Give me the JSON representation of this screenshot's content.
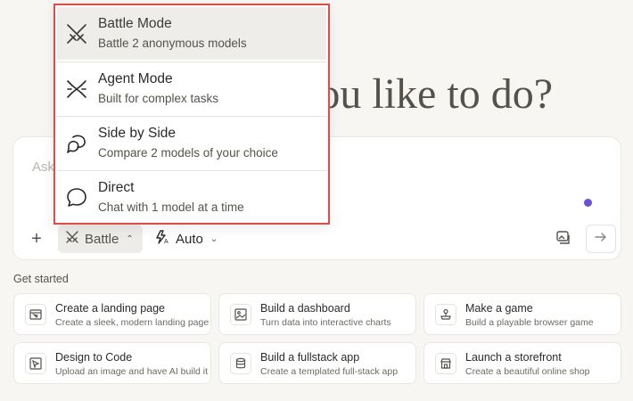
{
  "headline": "ou like to do?",
  "composer": {
    "placeholder": "Ask",
    "mode_label": "Battle",
    "model_label": "Auto"
  },
  "dropdown": {
    "options": [
      {
        "label": "Battle Mode",
        "desc": "Battle 2 anonymous models",
        "icon": "crossed-swords-icon",
        "selected": true
      },
      {
        "label": "Agent Mode",
        "desc": "Built for complex tasks",
        "icon": "agent-icon",
        "selected": false
      },
      {
        "label": "Side by Side",
        "desc": "Compare 2 models of your choice",
        "icon": "chat-bubbles-icon",
        "selected": false
      },
      {
        "label": "Direct",
        "desc": "Chat with 1 model at a time",
        "icon": "chat-bubble-icon",
        "selected": false
      }
    ]
  },
  "get_started": {
    "title": "Get started",
    "cards": [
      {
        "title": "Create a landing page",
        "subtitle": "Create a sleek, modern landing page",
        "icon": "browser-window-icon"
      },
      {
        "title": "Build a dashboard",
        "subtitle": "Turn data into interactive charts",
        "icon": "image-chart-icon"
      },
      {
        "title": "Make a game",
        "subtitle": "Build a playable browser game",
        "icon": "joystick-icon"
      },
      {
        "title": "Design to Code",
        "subtitle": "Upload an image and have AI build it",
        "icon": "cursor-frame-icon"
      },
      {
        "title": "Build a fullstack app",
        "subtitle": "Create a templated full-stack app",
        "icon": "database-icon"
      },
      {
        "title": "Launch a storefront",
        "subtitle": "Create a beautiful online shop",
        "icon": "store-icon"
      }
    ]
  },
  "colors": {
    "background": "#f7f6f3",
    "accent_dot": "#6b4fd8",
    "highlight_border": "#e04a4a",
    "selected_bg": "#efedea"
  }
}
